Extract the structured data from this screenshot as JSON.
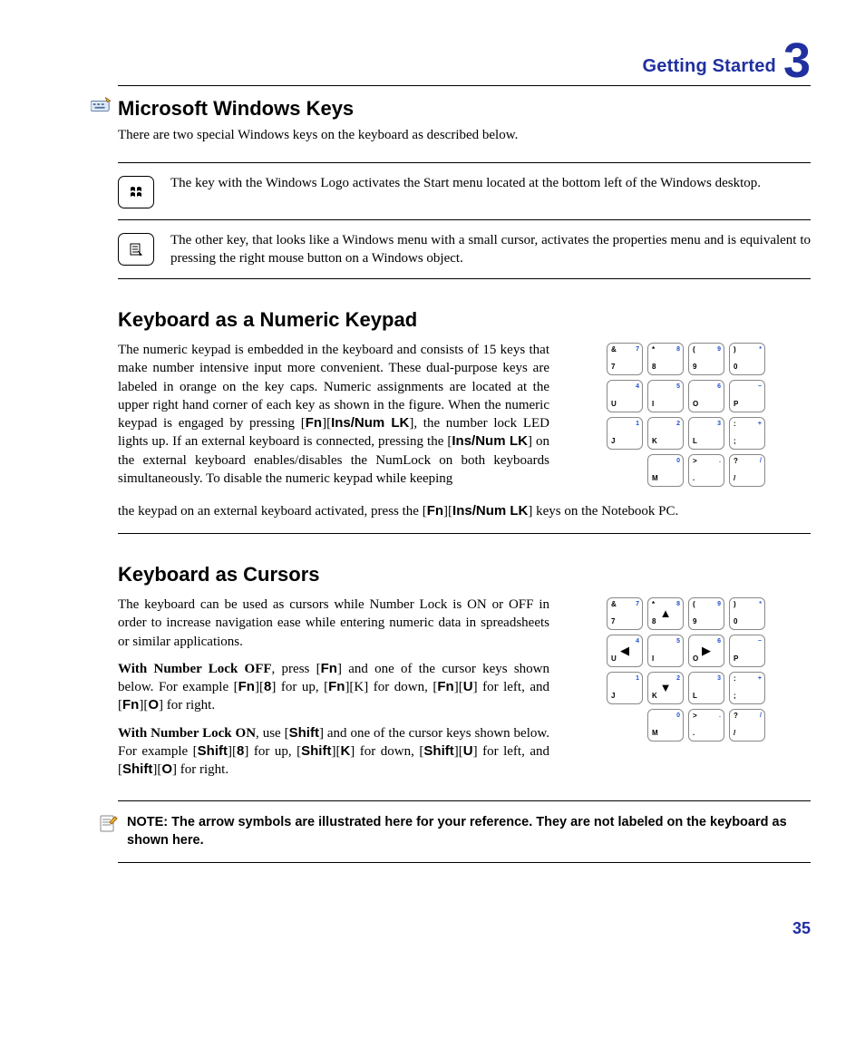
{
  "header": {
    "label": "Getting Started",
    "chapter": "3"
  },
  "s1": {
    "title": "Microsoft Windows Keys",
    "intro": "There are two special Windows keys on the keyboard as described below.",
    "key1_desc": "The key with the Windows Logo activates the Start menu located at the bottom left of the Windows desktop.",
    "key2_desc": "The other key, that looks like a Windows menu with a small cursor, activates the properties menu and is equivalent to pressing the right mouse button on a Windows object."
  },
  "s2": {
    "title": "Keyboard as a Numeric Keypad",
    "body_pre": "The numeric keypad is embedded in the keyboard and consists of 15 keys that make number intensive input more convenient. These dual-purpose keys are labeled in orange on the key caps. Numeric assignments are located at the upper right hand corner of each key as shown in the figure. When the numeric keypad is engaged by pressing [",
    "fn": "Fn",
    "mid1": "][",
    "ins": "Ins/Num LK",
    "mid2": "], the number lock LED lights up. If an external keyboard is connected, pressing the [",
    "mid3": "] on the external keyboard enables/disables the NumLock on both keyboards simultaneously. To disable the numeric keypad while keeping",
    "cont_pre": "the keypad on an external keyboard activated, press the  [",
    "cont_mid": "][",
    "cont_post": "] keys on the Notebook PC."
  },
  "s3": {
    "title": "Keyboard as Cursors",
    "p1": "The keyboard can be used as cursors while Number Lock is ON or OFF in order to increase navigation ease while entering numeric data in spreadsheets or similar applications.",
    "p2_lead": "With Number Lock OFF",
    "p2_rest": ", press [",
    "fn": "Fn",
    "p2_a": "] and one of the cursor keys shown below. For example [",
    "p2_b": "][",
    "eight": "8",
    "p2_c": "] for up, [",
    "p2_d": "][K] for down, [",
    "U": "U",
    "p2_e": "] for left, and [",
    "O": "O",
    "p2_f": "] for right.",
    "p3_lead": "With Number Lock ON",
    "p3_rest": ", use [",
    "shift": "Shift",
    "p3_a": "] and one of the cursor keys shown below. For example [",
    "p3_b": "][",
    "p3_c": "] for up, [",
    "K": "K",
    "p3_d": "] for down, [",
    "p3_e": "] for left, and [",
    "p3_f": "] for right."
  },
  "note": "NOTE: The arrow symbols are illustrated here for your reference. They are not labeled on the keyboard as shown here.",
  "page": "35",
  "keys": {
    "r1": [
      {
        "tl": "&",
        "main": "7",
        "tr": "7"
      },
      {
        "tl": "*",
        "main": "8",
        "tr": "8"
      },
      {
        "tl": "(",
        "main": "9",
        "tr": "9"
      },
      {
        "tl": ")",
        "main": "0",
        "tr": "*"
      }
    ],
    "r2": [
      {
        "main": "U",
        "tr": "4"
      },
      {
        "main": "I",
        "tr": "5"
      },
      {
        "main": "O",
        "tr": "6"
      },
      {
        "main": "P",
        "tr": "−"
      }
    ],
    "r3": [
      {
        "main": "J",
        "tr": "1"
      },
      {
        "main": "K",
        "tr": "2"
      },
      {
        "main": "L",
        "tr": "3"
      },
      {
        "tl": ":",
        "main": ";",
        "tr": "+"
      }
    ],
    "r4": [
      {
        "main": "M",
        "tr": "0"
      },
      {
        "tl": ">",
        "main": ".",
        "tr": "."
      },
      {
        "tl": "?",
        "main": "/",
        "tr": "/"
      }
    ]
  },
  "arrows": {
    "up": "▲",
    "down": "▼",
    "left": "◀",
    "right": "▶"
  }
}
